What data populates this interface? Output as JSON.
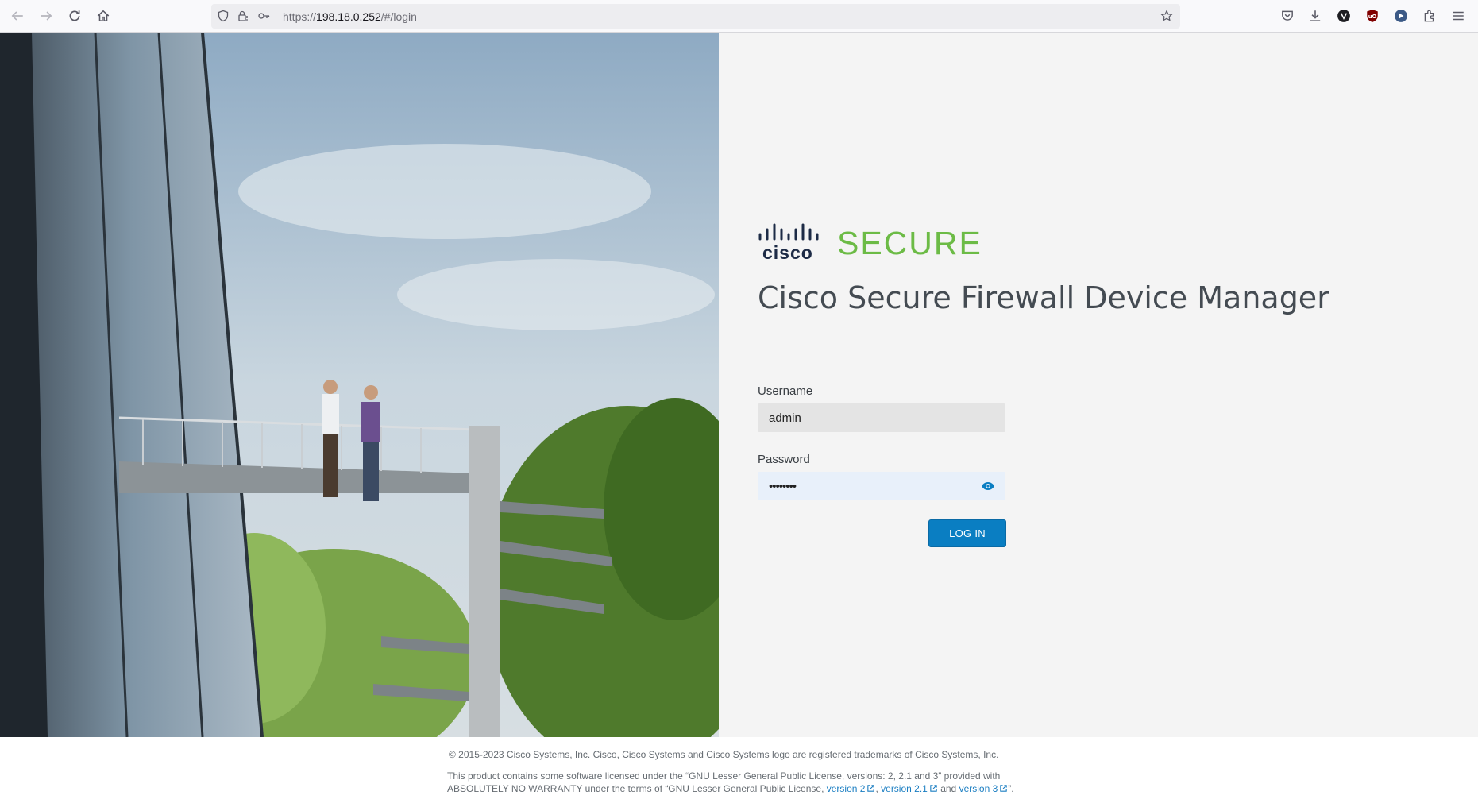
{
  "browser": {
    "url_scheme": "https://",
    "url_host": "198.18.0.252",
    "url_path": "/#/login"
  },
  "brand": {
    "logo_text": "cisco",
    "product_word": "SECURE",
    "app_title": "Cisco Secure Firewall Device Manager",
    "accent_green": "#6cbb46",
    "primary_blue": "#0a7ec2"
  },
  "login": {
    "username_label": "Username",
    "username_value": "admin",
    "password_label": "Password",
    "password_value": "••••••••",
    "login_button": "LOG IN"
  },
  "footer": {
    "copyright": "© 2015-2023 Cisco Systems, Inc. Cisco, Cisco Systems and Cisco Systems logo are registered trademarks of Cisco Systems, Inc.",
    "license_line1": "This product contains some software licensed under the “GNU Lesser General Public License, versions: 2, 2.1 and 3” provided with",
    "license_line2_prefix": "ABSOLUTELY NO WARRANTY under the terms of “GNU Lesser General Public License,",
    "link_v2": "version 2",
    "sep1": ",",
    "link_v21": "version 2.1",
    "and_text": "and",
    "link_v3": "version 3",
    "suffix": "”."
  }
}
